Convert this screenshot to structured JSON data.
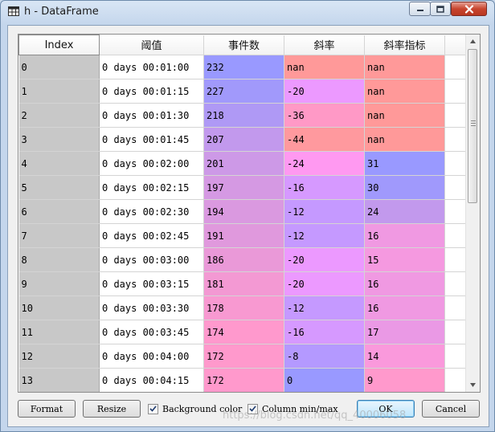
{
  "window": {
    "title": "h - DataFrame"
  },
  "columns": {
    "index": "Index",
    "threshold": "阈值",
    "events": "事件数",
    "slope": "斜率",
    "slope_index": "斜率指标"
  },
  "rows": [
    {
      "index": "0",
      "threshold": "0 days 00:01:00",
      "events": "232",
      "slope": "nan",
      "slope_index": "nan",
      "colors": [
        "#9999ff",
        "#ff9999",
        "#ff9999"
      ]
    },
    {
      "index": "1",
      "threshold": "0 days 00:01:15",
      "events": "227",
      "slope": "-20",
      "slope_index": "nan",
      "colors": [
        "#a199fb",
        "#ec99ff",
        "#ff9999"
      ]
    },
    {
      "index": "2",
      "threshold": "0 days 00:01:30",
      "events": "218",
      "slope": "-36",
      "slope_index": "nan",
      "colors": [
        "#af99f5",
        "#ff99c6",
        "#ff9999"
      ]
    },
    {
      "index": "3",
      "threshold": "0 days 00:01:45",
      "events": "207",
      "slope": "-44",
      "slope_index": "nan",
      "colors": [
        "#c299ed",
        "#ff999e",
        "#ff9999"
      ]
    },
    {
      "index": "4",
      "threshold": "0 days 00:02:00",
      "events": "201",
      "slope": "-24",
      "slope_index": "31",
      "colors": [
        "#cd99e7",
        "#ff99f1",
        "#9999ff"
      ]
    },
    {
      "index": "5",
      "threshold": "0 days 00:02:15",
      "events": "197",
      "slope": "-16",
      "slope_index": "30",
      "colors": [
        "#d599e3",
        "#d699ff",
        "#a099fc"
      ]
    },
    {
      "index": "6",
      "threshold": "0 days 00:02:30",
      "events": "194",
      "slope": "-12",
      "slope_index": "24",
      "colors": [
        "#da99e0",
        "#c599ff",
        "#c299ed"
      ]
    },
    {
      "index": "7",
      "threshold": "0 days 00:02:45",
      "events": "191",
      "slope": "-12",
      "slope_index": "16",
      "colors": [
        "#e099dd",
        "#c599ff",
        "#f099e2"
      ]
    },
    {
      "index": "8",
      "threshold": "0 days 00:03:00",
      "events": "186",
      "slope": "-20",
      "slope_index": "15",
      "colors": [
        "#ea99d8",
        "#ec99ff",
        "#f599e0"
      ]
    },
    {
      "index": "9",
      "threshold": "0 days 00:03:15",
      "events": "181",
      "slope": "-20",
      "slope_index": "16",
      "colors": [
        "#f399d3",
        "#ec99ff",
        "#f099e2"
      ]
    },
    {
      "index": "10",
      "threshold": "0 days 00:03:30",
      "events": "178",
      "slope": "-12",
      "slope_index": "16",
      "colors": [
        "#f899d1",
        "#c599ff",
        "#f099e2"
      ]
    },
    {
      "index": "11",
      "threshold": "0 days 00:03:45",
      "events": "174",
      "slope": "-16",
      "slope_index": "17",
      "colors": [
        "#ff99cd",
        "#d699ff",
        "#ea99e5"
      ]
    },
    {
      "index": "12",
      "threshold": "0 days 00:04:00",
      "events": "172",
      "slope": "-8",
      "slope_index": "14",
      "colors": [
        "#ff99cc",
        "#b499ff",
        "#fa99dc"
      ]
    },
    {
      "index": "13",
      "threshold": "0 days 00:04:15",
      "events": "172",
      "slope": "0",
      "slope_index": "9",
      "colors": [
        "#ff99cc",
        "#9999ff",
        "#ff99cc"
      ]
    }
  ],
  "toolbar": {
    "format_label": "Format",
    "resize_label": "Resize",
    "background_color_label": "Background color",
    "background_color_checked": true,
    "column_minmax_label": "Column min/max",
    "column_minmax_checked": true,
    "ok_label": "OK",
    "cancel_label": "Cancel"
  },
  "watermark": "https://blog.csdn.net/qq_40006058"
}
